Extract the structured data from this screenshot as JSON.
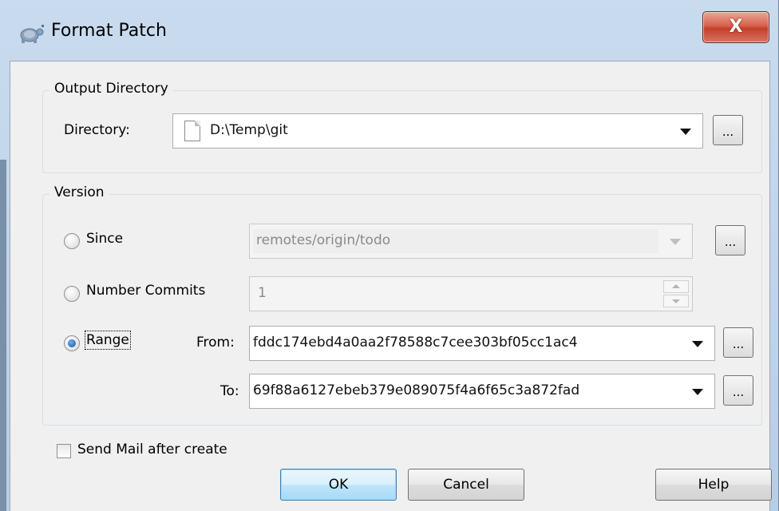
{
  "window": {
    "title": "Format Patch",
    "close_glyph": "X"
  },
  "output_group": {
    "legend": "Output Directory",
    "directory_label": "Directory:",
    "directory_value": "D:\\Temp\\git",
    "browse_label": "..."
  },
  "version_group": {
    "legend": "Version",
    "since": {
      "label": "Since",
      "value": "remotes/origin/todo",
      "checked": false,
      "enabled": false
    },
    "number_commits": {
      "label": "Number Commits",
      "value": "1",
      "checked": false,
      "enabled": false
    },
    "range": {
      "label": "Range",
      "checked": true,
      "from_label": "From:",
      "from_value": "fddc174ebd4a0aa2f78588c7cee303bf05cc1ac4",
      "to_label": "To:",
      "to_value": "69f88a6127ebeb379e089075f4a6f65c3a872fad"
    },
    "browse_label": "..."
  },
  "send_mail": {
    "label": "Send Mail after create",
    "checked": false
  },
  "buttons": {
    "ok": "OK",
    "cancel": "Cancel",
    "help": "Help"
  },
  "icons": {
    "app": "tortoisegit-icon",
    "file": "document-icon"
  }
}
